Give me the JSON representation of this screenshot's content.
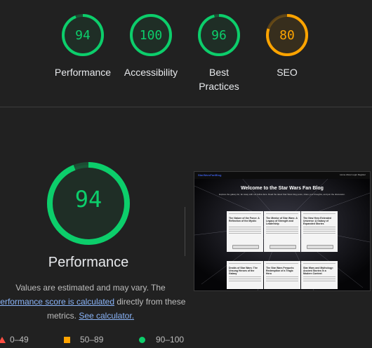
{
  "categories": [
    {
      "score": "94",
      "label": "Performance",
      "color": "#0cce6b",
      "fraction": 0.94
    },
    {
      "score": "100",
      "label": "Accessibility",
      "color": "#0cce6b",
      "fraction": 1.0
    },
    {
      "score": "96",
      "label": "Best Practices",
      "color": "#0cce6b",
      "fraction": 0.96
    },
    {
      "score": "80",
      "label": "SEO",
      "color": "#ffa400",
      "fraction": 0.8
    }
  ],
  "main": {
    "score": "94",
    "fraction": 0.94,
    "color": "#0cce6b",
    "title": "Performance",
    "note_prefix": "Values are estimated and may vary. The ",
    "note_link": "performance score is calculated",
    "note_mid": " directly from these metrics. ",
    "note_calc": "See calculator."
  },
  "legend": [
    {
      "range": "0–49",
      "color": "#ff4e42",
      "icon": "triangle-icon"
    },
    {
      "range": "50–89",
      "color": "#ffa400",
      "icon": "square-icon"
    },
    {
      "range": "90–100",
      "color": "#0cce6b",
      "icon": "circle-icon"
    }
  ],
  "screenshot": {
    "brand": "StarWarsFanBlog",
    "nav": "Home  About  Login  Register",
    "heading": "Welcome to the Star Wars Fan Blog",
    "subtitle": "Explore the galaxy far, far away with our fellow fans. Read the latest Star Wars blog posts, share your thoughts, and join the discussion.",
    "cards": [
      "The Nature of the Force: A Reflection of the Mystic",
      "The Mentor of Star Wars: A Legacy of Strength and Leadership",
      "The New Hero Extended Universe: A Galaxy of Expanded Stories",
      "Droids of Star Wars: The Unsung Heroes of the Galaxy",
      "The Star Wars Prequels: Redemption of a Tragic Hero",
      "Star Wars and Mythology: Ancient Stories in a Modern Context"
    ]
  }
}
